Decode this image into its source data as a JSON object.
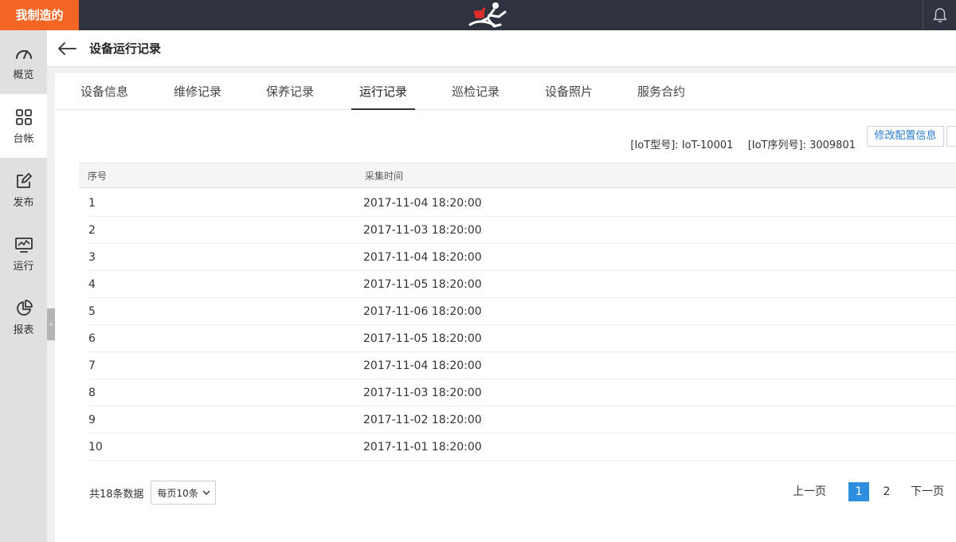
{
  "topbar": {
    "brand": "我制造的",
    "logo_icon": "running-man-logo-icon",
    "bell_icon": "bell-icon"
  },
  "sidebar": {
    "items": [
      {
        "label": "概览",
        "icon": "gauge-icon",
        "active": false
      },
      {
        "label": "台帐",
        "icon": "grid-icon",
        "active": true
      },
      {
        "label": "发布",
        "icon": "edit-icon",
        "active": false
      },
      {
        "label": "运行",
        "icon": "monitor-chart-icon",
        "active": false
      },
      {
        "label": "报表",
        "icon": "pie-chart-icon",
        "active": false
      }
    ],
    "collapse_glyph": "›"
  },
  "header": {
    "title": "设备运行记录",
    "back_icon": "arrow-left-icon"
  },
  "tabs": [
    {
      "label": "设备信息"
    },
    {
      "label": "维修记录"
    },
    {
      "label": "保养记录"
    },
    {
      "label": "运行记录",
      "active": true
    },
    {
      "label": "巡检记录"
    },
    {
      "label": "设备照片"
    },
    {
      "label": "服务合约"
    }
  ],
  "iot": {
    "model_label": "[IoT型号]:",
    "model_value": "IoT-10001",
    "serial_label": "[IoT序列号]:",
    "serial_value": "3009801",
    "config_button": "修改配置信息"
  },
  "table": {
    "columns": [
      "序号",
      "采集时间"
    ],
    "rows": [
      [
        "1",
        "2017-11-04 18:20:00"
      ],
      [
        "2",
        "2017-11-03 18:20:00"
      ],
      [
        "3",
        "2017-11-04 18:20:00"
      ],
      [
        "4",
        "2017-11-05 18:20:00"
      ],
      [
        "5",
        "2017-11-06 18:20:00"
      ],
      [
        "6",
        "2017-11-05 18:20:00"
      ],
      [
        "7",
        "2017-11-04 18:20:00"
      ],
      [
        "8",
        "2017-11-03 18:20:00"
      ],
      [
        "9",
        "2017-11-02 18:20:00"
      ],
      [
        "10",
        "2017-11-01 18:20:00"
      ]
    ]
  },
  "pagination": {
    "total_text": "共18条数据",
    "page_size": "每页10条",
    "prev": "上一页",
    "pages": [
      "1",
      "2"
    ],
    "current": "1",
    "next": "下一页"
  }
}
